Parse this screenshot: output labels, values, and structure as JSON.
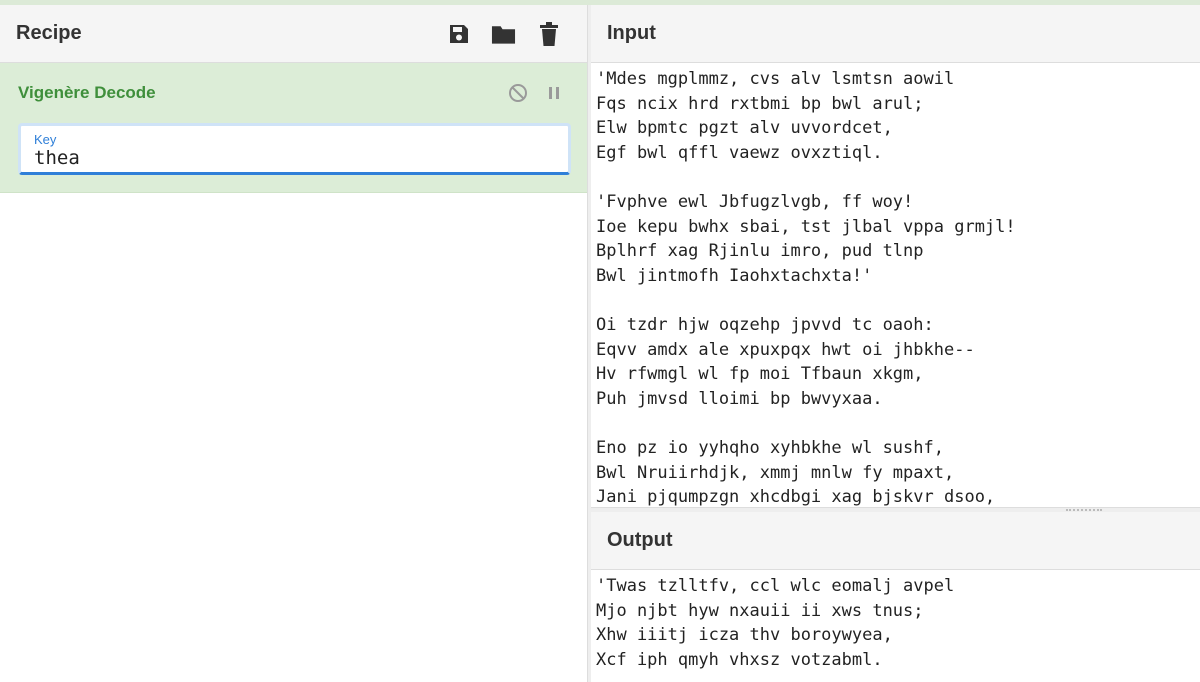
{
  "recipe": {
    "title": "Recipe",
    "icons": [
      "save-icon",
      "folder-icon",
      "trash-icon"
    ],
    "operation": {
      "name": "Vigenère Decode",
      "key_label": "Key",
      "key_value": "thea",
      "controls": [
        "disable-icon",
        "pause-icon"
      ]
    }
  },
  "input": {
    "title": "Input",
    "lines": [
      "'Mdes mgplmmz, cvs alv lsmtsn aowil",
      "Fqs ncix hrd rxtbmi bp bwl arul;",
      "Elw bpmtc pgzt alv uvvordcet,",
      "Egf bwl qffl vaewz ovxztiql.",
      "",
      "'Fvphve ewl Jbfugzlvgb, ff woy!",
      "Ioe kepu bwhx sbai, tst jlbal vppa grmjl!",
      "Bplhrf xag Rjinlu imro, pud tlnp",
      "Bwl jintmofh Iaohxtachxta!'",
      "",
      "Oi tzdr hjw oqzehp jpvvd tc oaoh:",
      "Eqvv amdx ale xpuxpqx hwt oi jhbkhe--",
      "Hv rfwmgl wl fp moi Tfbaun xkgm,",
      "Puh jmvsd lloimi bp bwvyxaa.",
      "",
      "Eno pz io yyhqho xyhbkhe wl sushf,",
      "Bwl Nruiirhdjk, xmmj mnlw fy mpaxt,",
      "Jani pjqumpzgn xhcdbgi xag bjskvr dsoo,"
    ]
  },
  "output": {
    "title": "Output",
    "lines": [
      "'Twas tzlltfv, ccl wlc eomalj avpel",
      "Mjo njbt hyw nxauii ii xws tnus;",
      "Xhw iiitj icza thv boroywyea,",
      "Xcf iph qmyh vhxsz votzabml."
    ]
  },
  "colors": {
    "operation_bg": "#dcedd7",
    "operation_title": "#3f8f3b",
    "key_accent": "#2f7fd8",
    "header_bg": "#f5f5f5"
  }
}
